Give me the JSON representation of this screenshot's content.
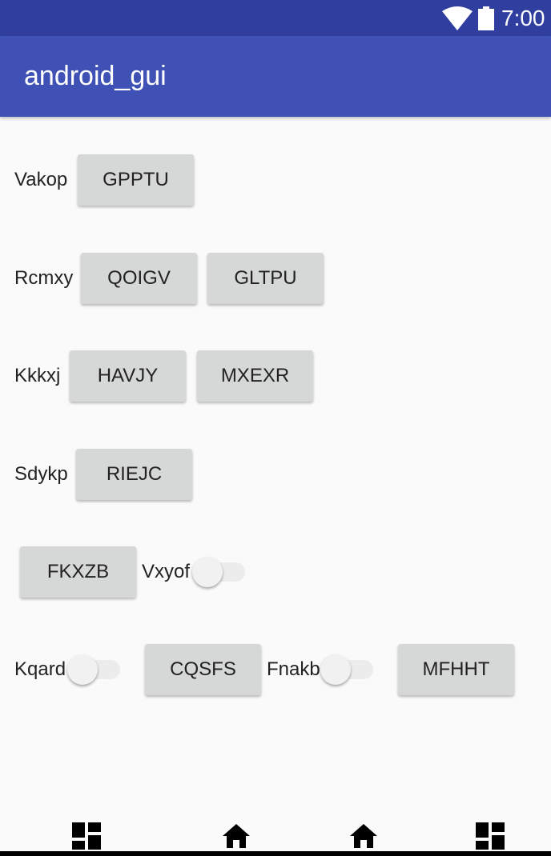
{
  "status_bar": {
    "time": "7:00",
    "wifi_icon": "wifi-icon",
    "battery_icon": "battery-icon"
  },
  "app_bar": {
    "title": "android_gui"
  },
  "rows": {
    "row1": {
      "label": "Vakop",
      "button": "GPPTU"
    },
    "row2": {
      "label": "Rcmxy",
      "button1": "QOIGV",
      "button2": "GLTPU"
    },
    "row3": {
      "label": "Kkkxj",
      "button1": "HAVJY",
      "button2": "MXEXR"
    },
    "row4": {
      "label": "Sdykp",
      "button": "RIEJC"
    },
    "row5": {
      "button": "FKXZB",
      "switch_label": "Vxyof",
      "switch_on": false
    },
    "row6": {
      "switch1_label": "Kqard",
      "switch1_on": false,
      "button1": "CQSFS",
      "switch2_label": "Fnakb",
      "switch2_on": false,
      "button2": "MFHHT"
    }
  },
  "nav_bar": {
    "icons": [
      "dashboard-icon",
      "home-icon",
      "home-icon",
      "dashboard-icon"
    ]
  },
  "colors": {
    "status_bar": "#303f9f",
    "app_bar": "#3f51b5",
    "background": "#fafafa",
    "button": "#d6d7d7"
  }
}
